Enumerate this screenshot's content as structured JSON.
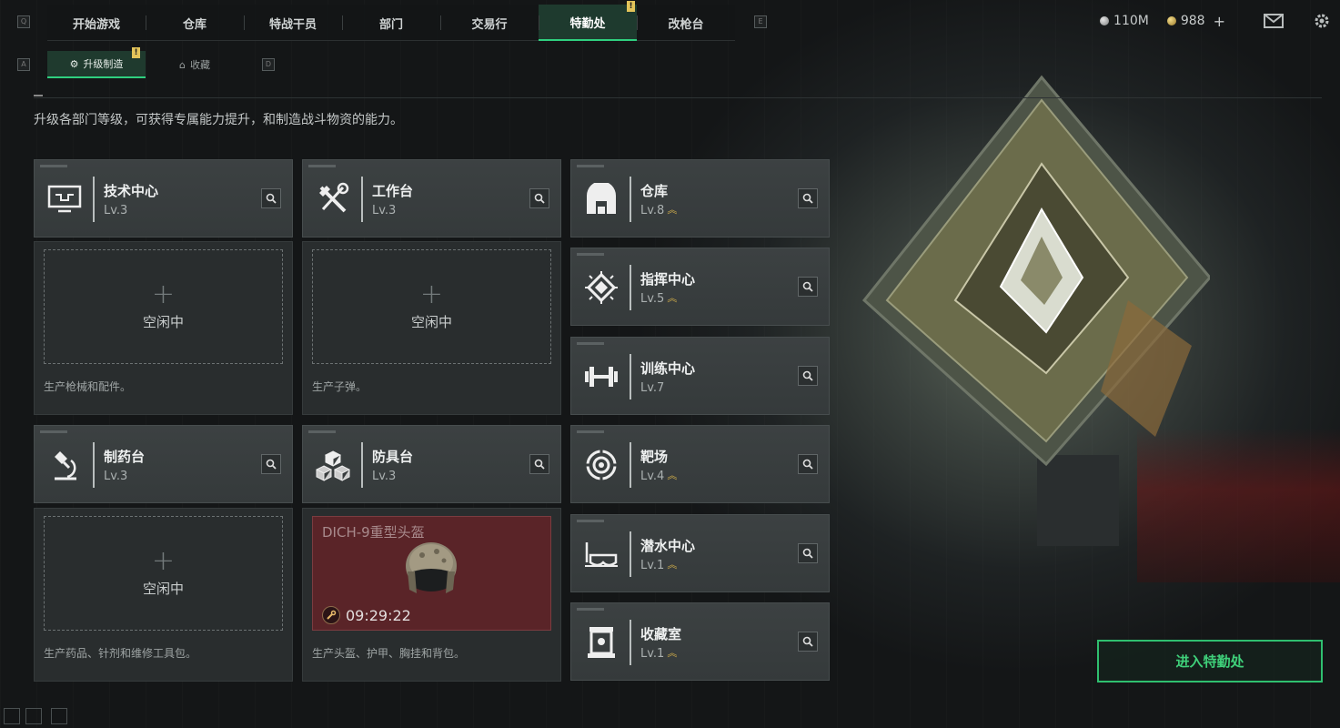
{
  "topnav": {
    "tabs": [
      {
        "label": "开始游戏",
        "active": false,
        "badge": ""
      },
      {
        "label": "仓库",
        "active": false,
        "badge": ""
      },
      {
        "label": "特战干员",
        "active": false,
        "badge": ""
      },
      {
        "label": "部门",
        "active": false,
        "badge": ""
      },
      {
        "label": "交易行",
        "active": false,
        "badge": ""
      },
      {
        "label": "特勤处",
        "active": true,
        "badge": "!"
      },
      {
        "label": "改枪台",
        "active": false,
        "badge": ""
      }
    ],
    "key_left": "Q",
    "key_right": "E"
  },
  "currency": {
    "silver": "110M",
    "gold": "988",
    "gold_add": "+"
  },
  "subnav": {
    "key_left": "A",
    "key_right": "D",
    "tabs": [
      {
        "label": "升级制造",
        "active": true,
        "badge": "!"
      },
      {
        "label": "收藏",
        "active": false,
        "badge": ""
      }
    ]
  },
  "description": "升级各部门等级，可获得专属能力提升，和制造战斗物资的能力。",
  "departments_left": [
    {
      "name": "技术中心",
      "level": "Lv.3",
      "icon": "monitor-icon",
      "status": "idle",
      "idle_label": "空闲中",
      "desc": "生产枪械和配件。"
    },
    {
      "name": "工作台",
      "level": "Lv.3",
      "icon": "tools-icon",
      "status": "idle",
      "idle_label": "空闲中",
      "desc": "生产子弹。"
    },
    {
      "name": "制药台",
      "level": "Lv.3",
      "icon": "microscope-icon",
      "status": "idle",
      "idle_label": "空闲中",
      "desc": "生产药品、针剂和维修工具包。"
    },
    {
      "name": "防具台",
      "level": "Lv.3",
      "icon": "boxes-icon",
      "status": "producing",
      "product": "DICH-9重型头盔",
      "timer": "09:29:22",
      "desc": "生产头盔、护甲、胸挂和背包。"
    }
  ],
  "departments_right": [
    {
      "name": "仓库",
      "level": "Lv.8",
      "icon": "warehouse-icon",
      "upgrade": true
    },
    {
      "name": "指挥中心",
      "level": "Lv.5",
      "icon": "chip-icon",
      "upgrade": true
    },
    {
      "name": "训练中心",
      "level": "Lv.7",
      "icon": "dumbbell-icon",
      "upgrade": false
    },
    {
      "name": "靶场",
      "level": "Lv.4",
      "icon": "target-icon",
      "upgrade": true
    },
    {
      "name": "潜水中心",
      "level": "Lv.1",
      "icon": "diving-mask-icon",
      "upgrade": true
    },
    {
      "name": "收藏室",
      "level": "Lv.1",
      "icon": "display-case-icon",
      "upgrade": true
    }
  ],
  "enter_button": "进入特勤处",
  "colors": {
    "accent": "#2fd07f",
    "badge": "#e3c45a",
    "upgrade": "#d9b34a",
    "producing_bg": "#5a2428"
  }
}
